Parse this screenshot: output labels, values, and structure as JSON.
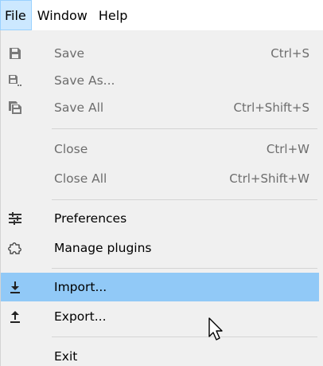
{
  "menubar": {
    "items": [
      {
        "label": "File"
      },
      {
        "label": "Window"
      },
      {
        "label": "Help"
      }
    ]
  },
  "file_menu": {
    "items": [
      {
        "label": "Save",
        "shortcut": "Ctrl+S",
        "icon": "save-icon",
        "enabled": false
      },
      {
        "label": "Save As...",
        "shortcut": "",
        "icon": "save-as-icon",
        "enabled": false
      },
      {
        "label": "Save All",
        "shortcut": "Ctrl+Shift+S",
        "icon": "save-all-icon",
        "enabled": false
      },
      {
        "label": "Close",
        "shortcut": "Ctrl+W",
        "icon": "",
        "enabled": false
      },
      {
        "label": "Close All",
        "shortcut": "Ctrl+Shift+W",
        "icon": "",
        "enabled": false
      },
      {
        "label": "Preferences",
        "shortcut": "",
        "icon": "sliders-icon",
        "enabled": true
      },
      {
        "label": "Manage plugins",
        "shortcut": "",
        "icon": "puzzle-icon",
        "enabled": true
      },
      {
        "label": "Import...",
        "shortcut": "",
        "icon": "import-icon",
        "enabled": true,
        "highlighted": true
      },
      {
        "label": "Export...",
        "shortcut": "",
        "icon": "export-icon",
        "enabled": true
      },
      {
        "label": "Exit",
        "shortcut": "",
        "icon": "",
        "enabled": true
      }
    ]
  },
  "colors": {
    "menubar_active_bg": "#cce8ff",
    "dropdown_bg": "#f0f0f0",
    "highlight_bg": "#91c9f7",
    "disabled_text": "#6d6d6d",
    "disabled_icon": "#7a7a7a"
  }
}
